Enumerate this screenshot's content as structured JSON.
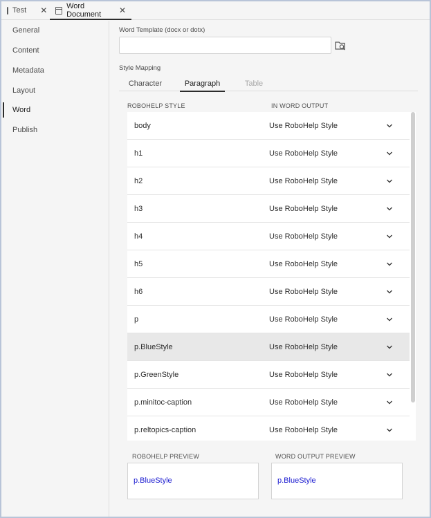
{
  "tabs": [
    {
      "label": "Test",
      "close": "✕"
    },
    {
      "label": "Word Document",
      "close": "✕"
    }
  ],
  "sidebar": {
    "items": [
      {
        "label": "General"
      },
      {
        "label": "Content"
      },
      {
        "label": "Metadata"
      },
      {
        "label": "Layout"
      },
      {
        "label": "Word"
      },
      {
        "label": "Publish"
      }
    ],
    "active": "Word"
  },
  "template": {
    "label": "Word Template (docx or dotx)",
    "value": "",
    "browse_icon": "folder-search-icon"
  },
  "style_mapping": {
    "label": "Style Mapping",
    "tabs": [
      {
        "label": "Character"
      },
      {
        "label": "Paragraph"
      },
      {
        "label": "Table"
      }
    ],
    "active_tab": "Paragraph",
    "col_robohelp": "ROBOHELP STYLE",
    "col_word": "IN WORD OUTPUT",
    "rows": [
      {
        "style": "body",
        "output": "Use RoboHelp Style"
      },
      {
        "style": "h1",
        "output": "Use RoboHelp Style"
      },
      {
        "style": "h2",
        "output": "Use RoboHelp Style"
      },
      {
        "style": "h3",
        "output": "Use RoboHelp Style"
      },
      {
        "style": "h4",
        "output": "Use RoboHelp Style"
      },
      {
        "style": "h5",
        "output": "Use RoboHelp Style"
      },
      {
        "style": "h6",
        "output": "Use RoboHelp Style"
      },
      {
        "style": "p",
        "output": "Use RoboHelp Style"
      },
      {
        "style": "p.BlueStyle",
        "output": "Use RoboHelp Style"
      },
      {
        "style": "p.GreenStyle",
        "output": "Use RoboHelp Style"
      },
      {
        "style": "p.minitoc-caption",
        "output": "Use RoboHelp Style"
      },
      {
        "style": "p.reltopics-caption",
        "output": "Use RoboHelp Style"
      }
    ],
    "selected_row": "p.BlueStyle"
  },
  "preview": {
    "robohelp_label": "ROBOHELP PREVIEW",
    "robohelp_text": "p.BlueStyle",
    "word_label": "WORD OUTPUT PREVIEW",
    "word_text": "p.BlueStyle",
    "text_color": "#1a1ad0"
  }
}
